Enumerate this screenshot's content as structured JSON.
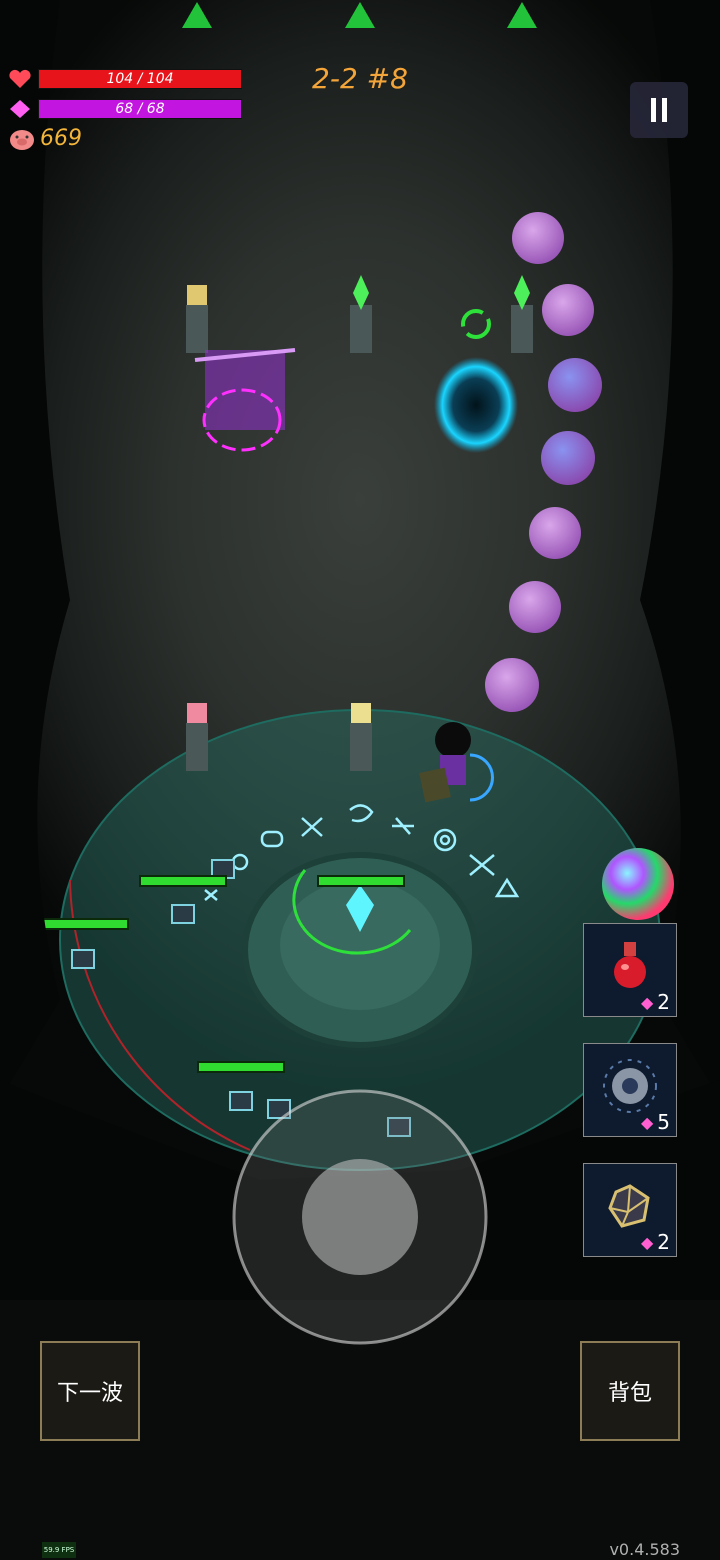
{
  "hud": {
    "hp": {
      "current": 104,
      "max": 104,
      "label": "104 / 104",
      "color": "#e8141c"
    },
    "mp": {
      "current": 68,
      "max": 68,
      "label": "68 / 68",
      "color": "#c215e0"
    },
    "coins": "669",
    "stage": "2-2 #8"
  },
  "items": [
    {
      "name": "red-potion",
      "cost": "2"
    },
    {
      "name": "orb-bomb",
      "cost": "5"
    },
    {
      "name": "gold-crystal",
      "cost": "2"
    }
  ],
  "buttons": {
    "next_wave": "下一波",
    "backpack": "背包"
  },
  "version": "v0.4.583",
  "fps": "59.9 FPS",
  "enemy_hp_fraction": [
    1,
    1,
    1,
    1
  ]
}
